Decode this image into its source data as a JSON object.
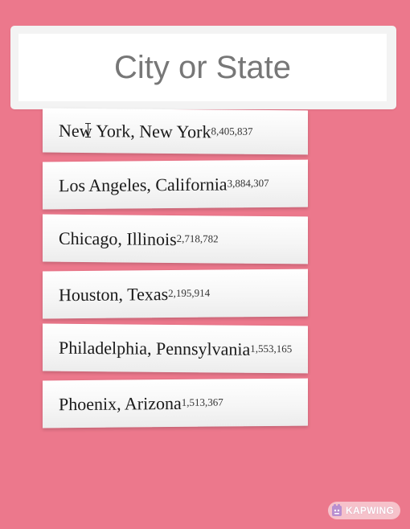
{
  "search": {
    "placeholder": "City or State",
    "value": ""
  },
  "suggestions": [
    {
      "name": "New York, New York",
      "population": "8,405,837"
    },
    {
      "name": "Los Angeles, California",
      "population": "3,884,307"
    },
    {
      "name": "Chicago, Illinois",
      "population": "2,718,782"
    },
    {
      "name": "Houston, Texas",
      "population": "2,195,914"
    },
    {
      "name": "Philadelphia, Pennsylvania",
      "population": "1,553,165"
    },
    {
      "name": "Phoenix, Arizona",
      "population": "1,513,367"
    }
  ],
  "watermark": {
    "text": "KAPWING",
    "icon": "kapwing-logo-icon"
  },
  "colors": {
    "background": "#ec788c",
    "input_background": "#ffffff",
    "placeholder": "#777777"
  }
}
